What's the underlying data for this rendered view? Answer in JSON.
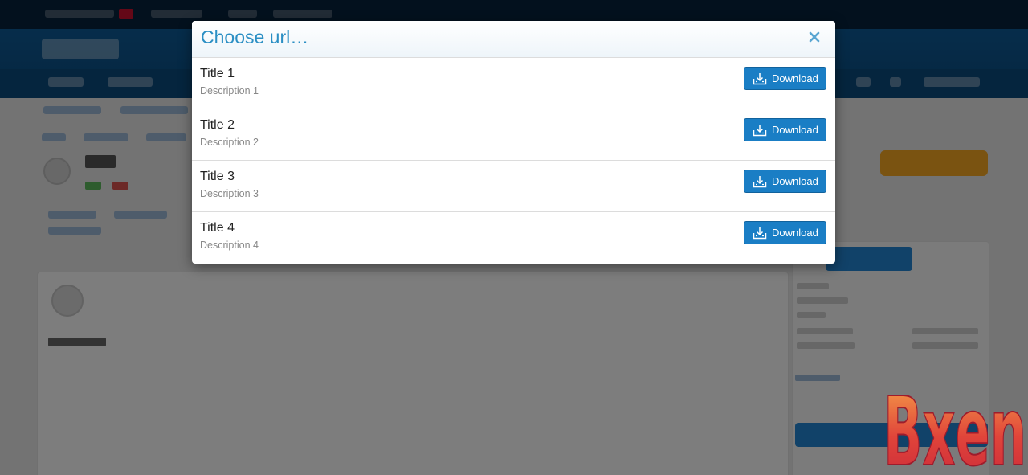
{
  "modal": {
    "title": "Choose url…",
    "close_icon": "close-icon",
    "items": [
      {
        "title": "Title 1",
        "description": "Description 1",
        "button_label": "Download"
      },
      {
        "title": "Title 2",
        "description": "Description 2",
        "button_label": "Download"
      },
      {
        "title": "Title 3",
        "description": "Description 3",
        "button_label": "Download"
      },
      {
        "title": "Title 4",
        "description": "Description 4",
        "button_label": "Download"
      }
    ],
    "button_icon": "download-icon"
  },
  "watermark": {
    "text": "Bxen"
  },
  "colors": {
    "title": "#2b8fc4",
    "button": "#1a7ec5",
    "overlay": "rgba(0,0,0,0.5)",
    "header_bg": "#0a4c80"
  }
}
